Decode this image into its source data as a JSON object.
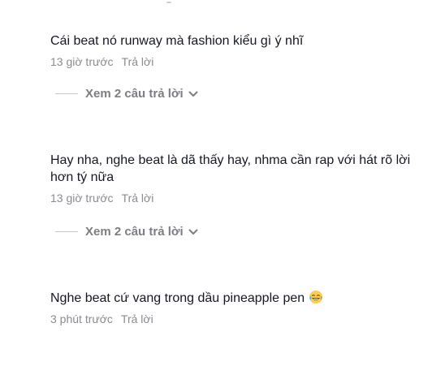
{
  "comments": [
    {
      "text": "Cái beat nó runway mà fashion kiểu gì ý nhĩ",
      "time": "13 giờ trước",
      "reply_label": "Trả lời",
      "view_replies": "Xem 2 câu trả lời"
    },
    {
      "text": "Hay nha, nghe beat là dã thấy hay, nhma cần rap với hát rõ lời hơn tý nữa",
      "time": "13 giờ trước",
      "reply_label": "Trả lời",
      "view_replies": "Xem 2 câu trả lời"
    },
    {
      "text": "Nghe beat cứ vang trong dầu pineapple pen",
      "emoji": "tears-of-joy-emoji",
      "time": "3 phút trước",
      "reply_label": "Trả lời"
    }
  ],
  "icons": {
    "expand": "chevron-down-icon"
  }
}
